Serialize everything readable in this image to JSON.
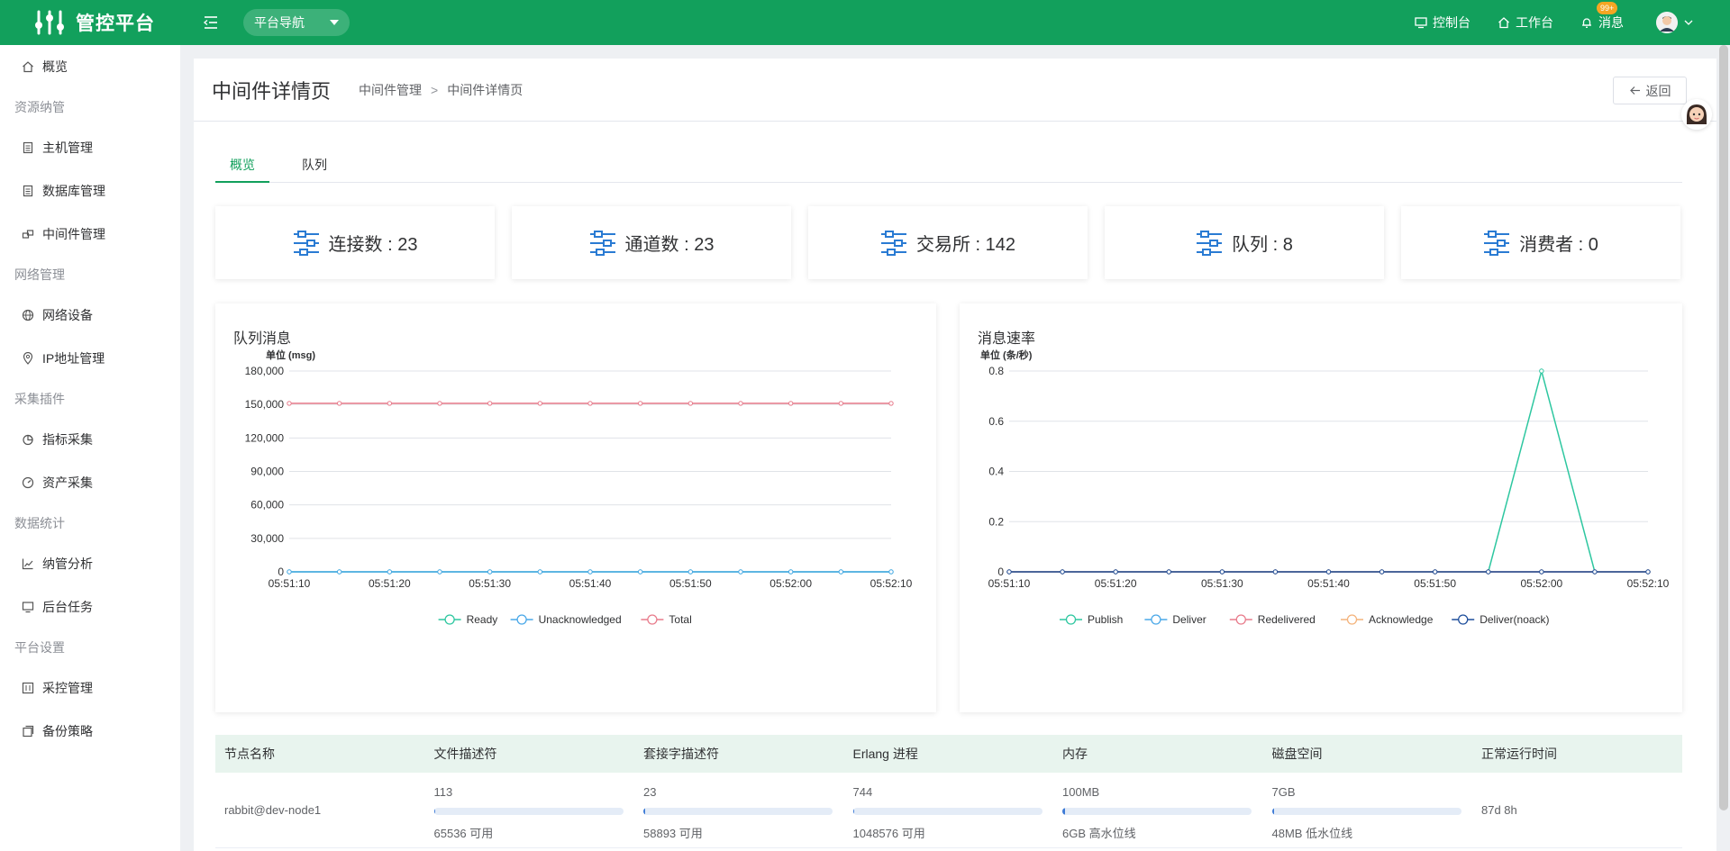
{
  "header": {
    "app_title": "管控平台",
    "nav_select_label": "平台导航",
    "links": [
      {
        "label": "控制台",
        "icon": "monitor-icon"
      },
      {
        "label": "工作台",
        "icon": "home-icon"
      },
      {
        "label": "消息",
        "icon": "bell-icon",
        "badge": "99+"
      }
    ]
  },
  "sidebar": {
    "overview": "概览",
    "groups": [
      {
        "title": "资源纳管",
        "items": [
          "主机管理",
          "数据库管理",
          "中间件管理"
        ]
      },
      {
        "title": "网络管理",
        "items": [
          "网络设备",
          "IP地址管理"
        ]
      },
      {
        "title": "采集插件",
        "items": [
          "指标采集",
          "资产采集"
        ]
      },
      {
        "title": "数据统计",
        "items": [
          "纳管分析",
          "后台任务"
        ]
      },
      {
        "title": "平台设置",
        "items": [
          "采控管理",
          "备份策略"
        ]
      }
    ]
  },
  "page": {
    "title": "中间件详情页",
    "breadcrumb": [
      "中间件管理",
      "中间件详情页"
    ],
    "breadcrumb_sep": ">",
    "back_label": "返回",
    "tabs": [
      "概览",
      "队列"
    ],
    "active_tab": 0
  },
  "stats": [
    {
      "label": "连接数 : 23"
    },
    {
      "label": "通道数 : 23"
    },
    {
      "label": "交易所 : 142"
    },
    {
      "label": "队列 : 8"
    },
    {
      "label": "消费者 : 0"
    }
  ],
  "colors": {
    "brand": "#12a05c",
    "ready": "#2ec7a0",
    "unacked": "#4aa8e8",
    "total": "#e87c8c",
    "acknowledge": "#f4b37c",
    "noack": "#1f4f9c"
  },
  "chart_data": [
    {
      "type": "line",
      "title": "队列消息",
      "unit_label": "单位 (msg)",
      "x": [
        "05:51:10",
        "05:51:15",
        "05:51:20",
        "05:51:25",
        "05:51:30",
        "05:51:35",
        "05:51:40",
        "05:51:45",
        "05:51:50",
        "05:51:55",
        "05:52:00",
        "05:52:05",
        "05:52:10"
      ],
      "x_ticks": [
        "05:51:10",
        "05:51:20",
        "05:51:30",
        "05:51:40",
        "05:51:50",
        "05:52:00",
        "05:52:10"
      ],
      "y_ticks": [
        "0",
        "30,000",
        "60,000",
        "90,000",
        "120,000",
        "150,000",
        "180,000"
      ],
      "ylim": [
        0,
        180000
      ],
      "series": [
        {
          "name": "Ready",
          "color": "#2ec7a0",
          "values": [
            0,
            0,
            0,
            0,
            0,
            0,
            0,
            0,
            0,
            0,
            0,
            0,
            0
          ]
        },
        {
          "name": "Unacknowledged",
          "color": "#4aa8e8",
          "values": [
            0,
            0,
            0,
            0,
            0,
            0,
            0,
            0,
            0,
            0,
            0,
            0,
            0
          ]
        },
        {
          "name": "Total",
          "color": "#e87c8c",
          "values": [
            151000,
            151000,
            151000,
            151000,
            151000,
            151000,
            151000,
            151000,
            151000,
            151000,
            151000,
            151000,
            151000
          ]
        }
      ],
      "legend": "bottom-center",
      "grid": true
    },
    {
      "type": "line",
      "title": "消息速率",
      "unit_label": "单位 (条/秒)",
      "x": [
        "05:51:10",
        "05:51:15",
        "05:51:20",
        "05:51:25",
        "05:51:30",
        "05:51:35",
        "05:51:40",
        "05:51:45",
        "05:51:50",
        "05:51:55",
        "05:52:00",
        "05:52:05",
        "05:52:10"
      ],
      "x_ticks": [
        "05:51:10",
        "05:51:20",
        "05:51:30",
        "05:51:40",
        "05:51:50",
        "05:52:00",
        "05:52:10"
      ],
      "y_ticks": [
        "0",
        "0.2",
        "0.4",
        "0.6",
        "0.8"
      ],
      "ylim": [
        0,
        0.8
      ],
      "series": [
        {
          "name": "Publish",
          "color": "#2ec7a0",
          "values": [
            0,
            0,
            0,
            0,
            0,
            0,
            0,
            0,
            0,
            0,
            0.8,
            0,
            0
          ]
        },
        {
          "name": "Deliver",
          "color": "#4aa8e8",
          "values": [
            0,
            0,
            0,
            0,
            0,
            0,
            0,
            0,
            0,
            0,
            0,
            0,
            0
          ]
        },
        {
          "name": "Redelivered",
          "color": "#e87c8c",
          "values": [
            0,
            0,
            0,
            0,
            0,
            0,
            0,
            0,
            0,
            0,
            0,
            0,
            0
          ]
        },
        {
          "name": "Acknowledge",
          "color": "#f4b37c",
          "values": [
            0,
            0,
            0,
            0,
            0,
            0,
            0,
            0,
            0,
            0,
            0,
            0,
            0
          ]
        },
        {
          "name": "Deliver(noack)",
          "color": "#1f4f9c",
          "values": [
            0,
            0,
            0,
            0,
            0,
            0,
            0,
            0,
            0,
            0,
            0,
            0,
            0
          ]
        }
      ],
      "legend": "bottom-center",
      "grid": true
    }
  ],
  "table": {
    "columns": [
      "节点名称",
      "文件描述符",
      "套接字描述符",
      "Erlang 进程",
      "内存",
      "磁盘空间",
      "正常运行时间"
    ],
    "rows": [
      {
        "node": "rabbit@dev-node1",
        "file_desc": {
          "used": "113",
          "avail": "65536 可用",
          "fraction": 0.002
        },
        "socket_desc": {
          "used": "23",
          "avail": "58893 可用",
          "fraction": 0.001
        },
        "erlang": {
          "used": "744",
          "avail": "1048576 可用",
          "fraction": 0.001
        },
        "memory": {
          "used": "100MB",
          "avail": "6GB 高水位线",
          "fraction": 0.016
        },
        "disk": {
          "used": "7GB",
          "avail": "48MB 低水位线",
          "fraction": 0.01
        },
        "uptime": "87d 8h"
      }
    ]
  }
}
